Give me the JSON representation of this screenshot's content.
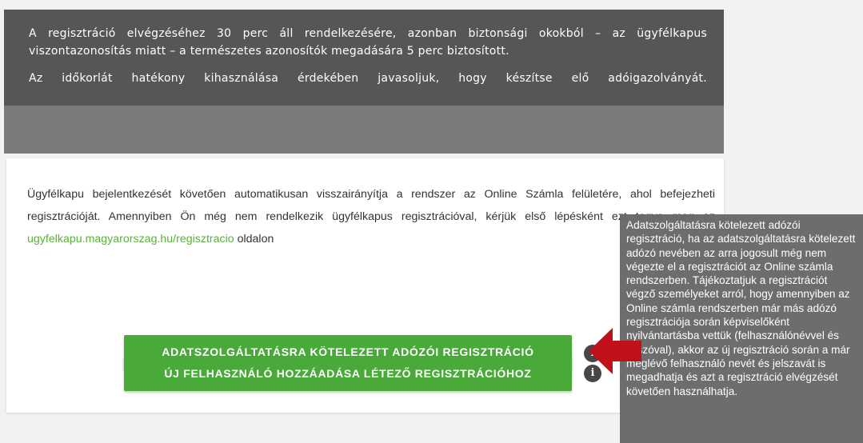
{
  "notice": {
    "paragraph1": "A regisztráció elvégzéséhez 30 perc áll rendelkezésére, azonban biztonsági okokból – az ügyfélkapus viszontazonosítás miatt – a természetes azonosítók megadására 5 perc biztosított.",
    "paragraph2": "Az időkorlát hatékony kihasználása érdekében javasoljuk, hogy készítse elő adóigazolványát."
  },
  "card": {
    "text_before_link": "Ügyfélkapu bejelentkezését követően automatikusan visszairányítja a rendszer az Online Számla felületére, ahol befejezheti regisztrációját. Amennyiben Ön még nem rendelkezik ügyfélkapus regisztrációval, kérjük első lépésként ezt tegye meg az ",
    "link_text": "ugyfelkapu.magyarorszag.hu/regisztracio",
    "text_after_link": " oldalon"
  },
  "buttons": {
    "taxpayer_registration": "ADATSZOLGÁLTATÁSRA KÖTELEZETT ADÓZÓI REGISZTRÁCIÓ",
    "add_user": "ÚJ FELHASZNÁLÓ HOZZÁADÁSA LÉTEZŐ REGISZTRÁCIÓHOZ"
  },
  "icons": {
    "info_glyph": "i"
  },
  "tooltip": {
    "text": "Adatszolgáltatásra kötelezett adózói regisztráció, ha az adatszolgáltatásra kötelezett adózó nevében az arra jogosult még nem végezte el a regisztrációt az Online számla rendszerben. Tájékoztatjuk a regisztrációt végző személyeket arról, hogy amennyiben az Online számla rendszerben már más adózó regisztrációja során képviselőként nyilvántartásba vettük (felhasználónévvel és jelszóval), akkor az új regisztráció során a már meglévő felhasználó nevét és jelszavát is megadhatja és azt a regisztráció elvégzését követően használhatja."
  },
  "colors": {
    "accent_green": "#49a939",
    "link_green": "#5cae3e",
    "arrow_red": "#c0101a"
  }
}
